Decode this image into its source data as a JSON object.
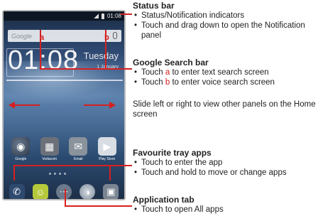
{
  "phone": {
    "status_time": "01:08",
    "search_label": "Google",
    "marker_a": "a",
    "marker_b": "b",
    "clock": "01:08",
    "day": "Tuesday",
    "date": "1 January",
    "apps": [
      {
        "label": "Google",
        "icon": "google-folder-icon"
      },
      {
        "label": "Vodacom",
        "icon": "vodacom-folder-icon"
      },
      {
        "label": "Email",
        "icon": "email-icon"
      },
      {
        "label": "Play Store",
        "icon": "play-store-icon"
      }
    ],
    "tray": [
      "phone-icon",
      "messaging-icon",
      "application-tab-icon",
      "browser-icon",
      "camera-icon"
    ]
  },
  "annotations": {
    "status_bar": {
      "heading": "Status bar",
      "items": [
        "Status/Notification indicators",
        "Touch and drag down to open the Notification panel"
      ]
    },
    "search_bar": {
      "heading": "Google Search bar",
      "item1_pre": "Touch ",
      "item1_letter": "a",
      "item1_post": " to enter text search screen",
      "item2_pre": "Touch ",
      "item2_letter": "b",
      "item2_post": " to enter voice search screen"
    },
    "slide": {
      "text": "Slide left or right to view other panels on the Home screen"
    },
    "favourite": {
      "heading": "Favourite tray apps",
      "items": [
        "Touch to enter the app",
        "Touch and hold to move or change apps"
      ]
    },
    "app_tab": {
      "heading": "Application tab",
      "items": [
        "Touch to open All apps"
      ]
    }
  },
  "colors": {
    "accent": "#d62020",
    "text": "#222222"
  }
}
